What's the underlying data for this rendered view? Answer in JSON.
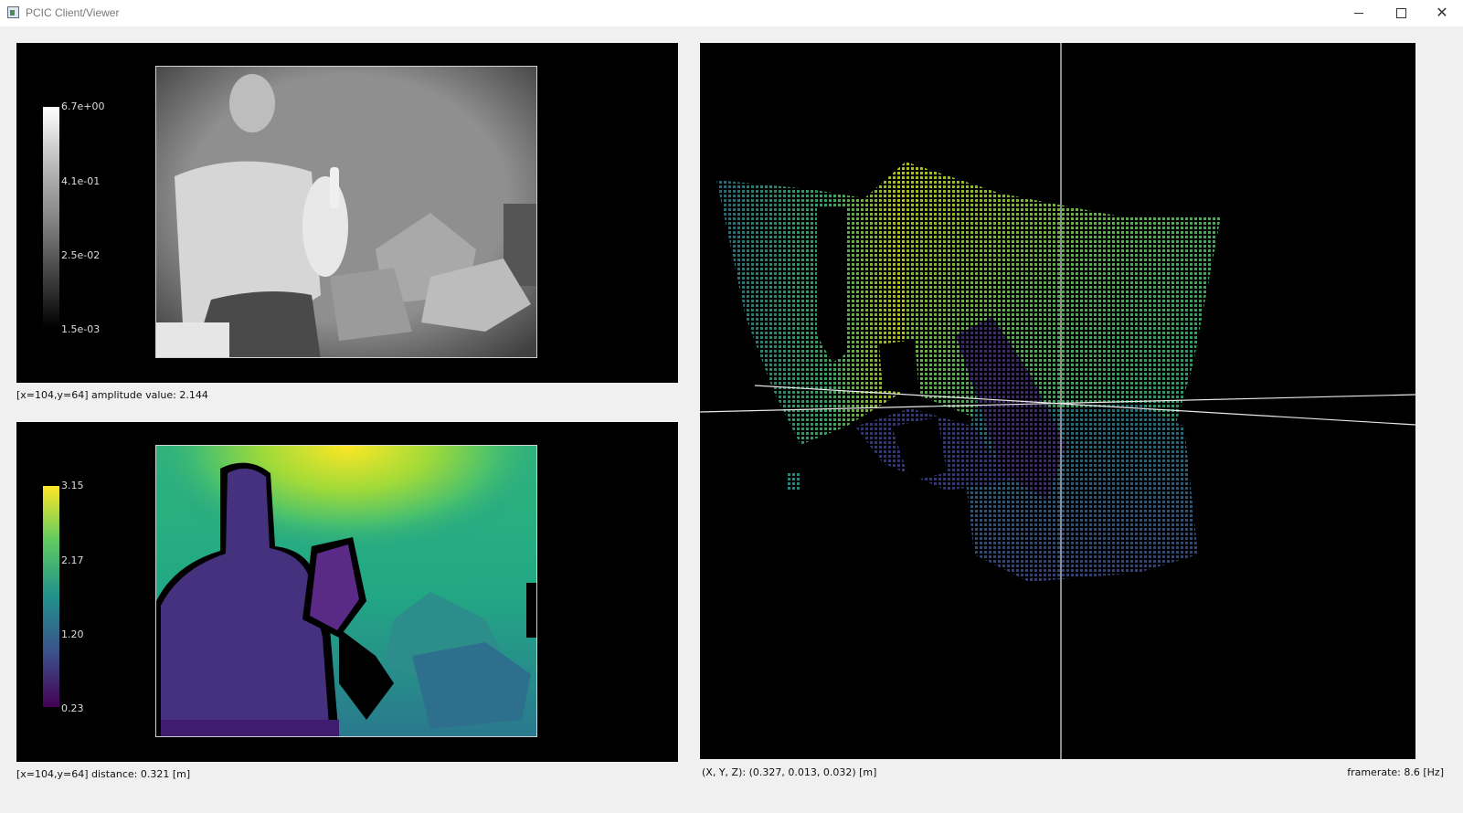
{
  "window": {
    "title": "PCIC Client/Viewer",
    "minimize_glyph": "",
    "maximize_glyph": "",
    "close_glyph": "✕"
  },
  "amplitude_view": {
    "colorbar": {
      "labels": [
        "6.7e+00",
        "4.1e-01",
        "2.5e-02",
        "1.5e-03"
      ],
      "colors": [
        "#ffffff",
        "#000000"
      ]
    },
    "status": "[x=104,y=64] amplitude value: 2.144"
  },
  "distance_view": {
    "colorbar": {
      "labels": [
        "3.15",
        "2.17",
        "1.20",
        "0.23"
      ],
      "colors": [
        "#fde725",
        "#5ec962",
        "#21918c",
        "#3b528b",
        "#440154"
      ]
    },
    "status": "[x=104,y=64] distance: 0.321 [m]"
  },
  "point_cloud_view": {
    "xyz_status": "(X, Y, Z): (0.327, 0.013, 0.032) [m]",
    "framerate_status": "framerate: 8.6 [Hz]"
  }
}
